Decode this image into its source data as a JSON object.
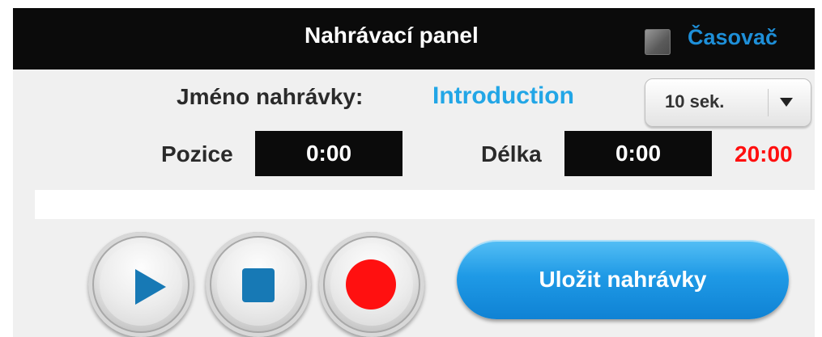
{
  "header": {
    "title": "Nahrávací panel",
    "timer_checkbox": {
      "checked": false
    },
    "timer_label": "Časovač"
  },
  "recording": {
    "name_label": "Jméno nahrávky:",
    "name_value": "Introduction",
    "timer_select": {
      "value": "10 sek.",
      "icon": "chevron-down-icon"
    }
  },
  "times": {
    "position_label": "Pozice",
    "position_value": "0:00",
    "length_label": "Délka",
    "length_value": "0:00",
    "max_length": "20:00"
  },
  "progress": {
    "value": 0
  },
  "controls": {
    "play_icon": "play-icon",
    "stop_icon": "stop-icon",
    "record_icon": "record-icon",
    "save_label": "Uložit nahrávky"
  },
  "colors": {
    "accent_blue": "#22a6e6",
    "header_bg": "#0b0b0b",
    "warning_red": "#ff0f0f",
    "record_red": "#ff1010",
    "icon_blue": "#1779b5"
  }
}
